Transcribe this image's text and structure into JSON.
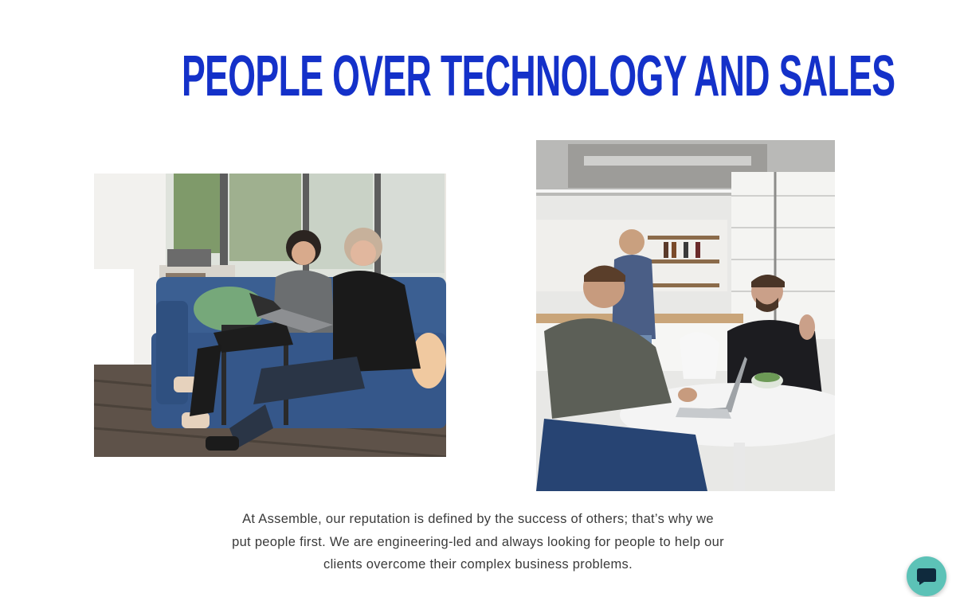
{
  "hero": {
    "title": "PEOPLE OVER TECHNOLOGY AND SALES",
    "title_color": "#1431c9"
  },
  "photos": {
    "left_icon": "image-photo",
    "right_icon": "image-photo"
  },
  "body": {
    "paragraph": "At Assemble, our reputation is defined by the success of others; that’s why we put people first. We are engineering-led and always looking for people to help our clients overcome their complex business problems."
  },
  "chat": {
    "icon": "chat-bubble-icon",
    "color": "#5cc2b7"
  }
}
